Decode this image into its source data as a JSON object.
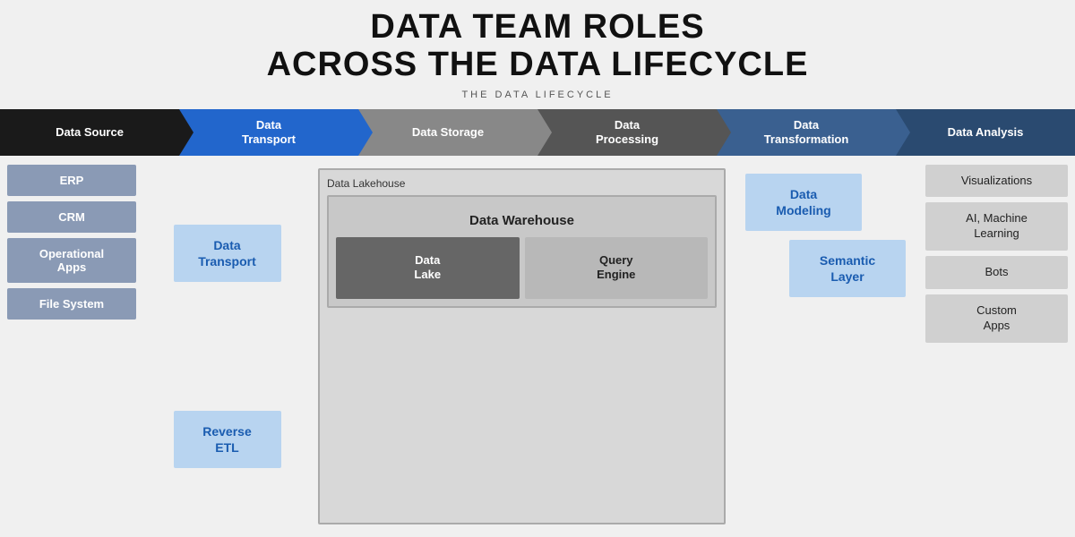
{
  "title": {
    "line1": "DATA TEAM ROLES",
    "line2": "ACROSS THE DATA LIFECYCLE",
    "subtitle": "THE DATA LIFECYCLE"
  },
  "pipeline": {
    "steps": [
      {
        "id": "data-source",
        "label": "Data Source",
        "style": "black"
      },
      {
        "id": "data-transport",
        "label": "Data\nTransport",
        "style": "blue"
      },
      {
        "id": "data-storage",
        "label": "Data Storage",
        "style": "gray-light"
      },
      {
        "id": "data-processing",
        "label": "Data\nProcessing",
        "style": "gray-dark"
      },
      {
        "id": "data-transformation",
        "label": "Data\nTransformation",
        "style": "teal"
      },
      {
        "id": "data-analysis",
        "label": "Data Analysis",
        "style": "dark-blue"
      }
    ]
  },
  "source_items": [
    "ERP",
    "CRM",
    "Operational Apps",
    "File System"
  ],
  "transport_items": [
    "Data\nTransport",
    "Reverse\nETL"
  ],
  "storage": {
    "lakehouse_label": "Data Lakehouse",
    "warehouse_label": "Data Warehouse",
    "datalake_label": "Data\nLake",
    "query_label": "Query\nEngine"
  },
  "transform_items": [
    "Data\nModeling",
    "Semantic\nLayer"
  ],
  "analysis_items": [
    "Visualizations",
    "AI, Machine\nLearning",
    "Bots",
    "Custom\nApps"
  ]
}
